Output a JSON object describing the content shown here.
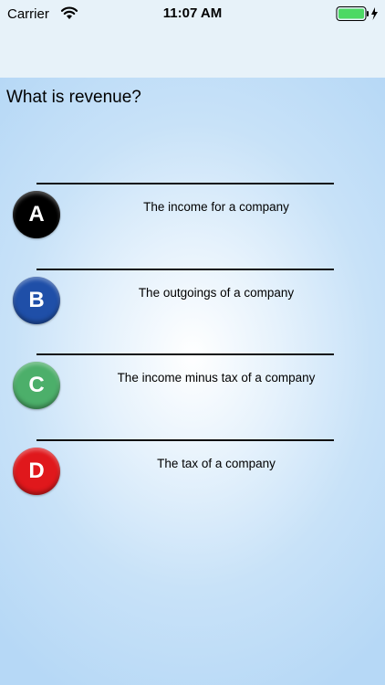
{
  "status_bar": {
    "carrier": "Carrier",
    "time": "11:07 AM",
    "wifi_icon": "wifi-icon",
    "battery_icon": "battery-charging-icon",
    "battery_color": "#4cd964"
  },
  "question": {
    "text": "What is revenue?"
  },
  "answers": [
    {
      "letter": "A",
      "text": "The income for a company",
      "color": "#000000"
    },
    {
      "letter": "B",
      "text": "The outgoings of a company",
      "color": "#1f4fa8"
    },
    {
      "letter": "C",
      "text": "The income minus tax of a company",
      "color": "#4caf6a"
    },
    {
      "letter": "D",
      "text": "The tax of a company",
      "color": "#e0181c"
    }
  ]
}
